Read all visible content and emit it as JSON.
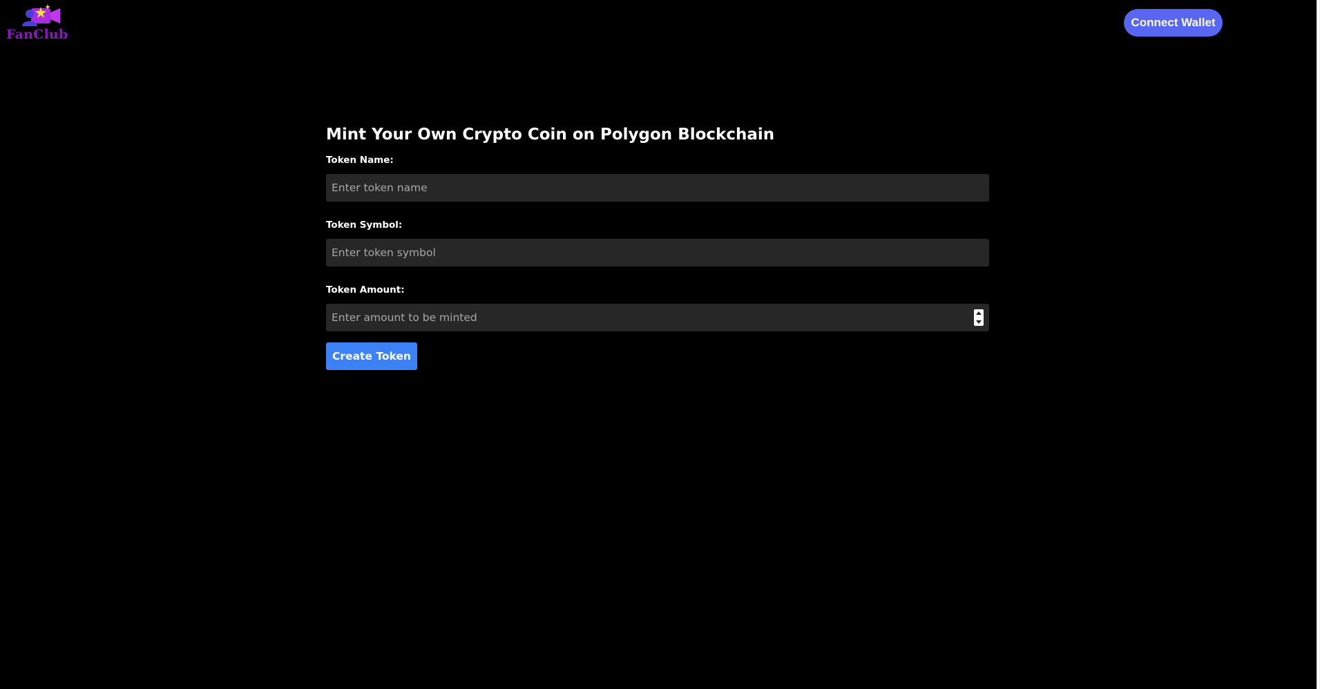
{
  "brand": {
    "name": "FanClub",
    "logo_icon": "video-camera-star-icon",
    "colors": {
      "logo_text": "#8f14c8",
      "person": "#4a3de0",
      "camera": "#a92ce0",
      "star": "#f6e23a"
    }
  },
  "header": {
    "connect_wallet_label": "Connect Wallet"
  },
  "form": {
    "title": "Mint Your Own Crypto Coin on Polygon Blockchain",
    "fields": [
      {
        "label": "Token Name:",
        "placeholder": "Enter token name",
        "value": ""
      },
      {
        "label": "Token Symbol:",
        "placeholder": "Enter token symbol",
        "value": ""
      },
      {
        "label": "Token Amount:",
        "placeholder": "Enter amount to be minted",
        "value": ""
      }
    ],
    "submit_label": "Create Token"
  },
  "theme": {
    "background": "#000000",
    "input_background": "#272727",
    "connect_button": "#5866f2",
    "submit_button": "#3c82f6"
  }
}
